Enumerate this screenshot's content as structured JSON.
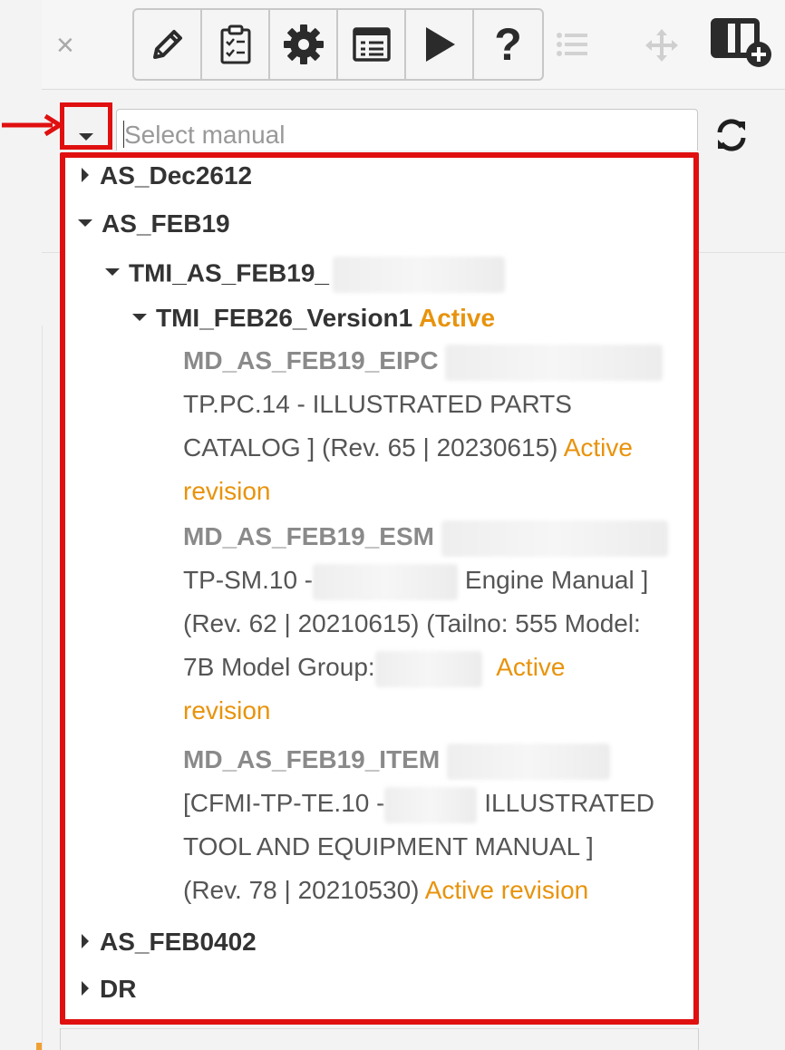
{
  "toolbar": {
    "close_icon": "×",
    "buttons": [
      "edit-pencil-icon",
      "clipboard-checklist-icon",
      "gear-icon",
      "list-document-icon",
      "play-icon",
      "help-question-icon"
    ],
    "help_glyph": "?"
  },
  "search": {
    "placeholder": "Select manual"
  },
  "tree": {
    "root1": "AS_Dec2612",
    "root2": "AS_FEB19",
    "child": "TMI_AS_FEB19_",
    "grandchild": "TMI_FEB26_Version1",
    "grandchild_status": "Active",
    "leaves": [
      {
        "code": "MD_AS_FEB19_EIPC",
        "line2": "TP.PC.14 - ILLUSTRATED PARTS",
        "line3_text": "CATALOG ] (Rev. 65 | 20230615)",
        "line3_status": "Active",
        "line4_status": "revision"
      },
      {
        "code": "MD_AS_FEB19_ESM",
        "line2_pre": "TP-SM.10 -",
        "line2_post": "Engine Manual ]",
        "line3": "(Rev. 62 | 20210615) (Tailno: 555 Model:",
        "line4_pre": "7B Model Group:",
        "line4_status": "Active",
        "line5_status": "revision"
      },
      {
        "code": "MD_AS_FEB19_ITEM",
        "line2_pre": "[CFMI-TP-TE.10 -",
        "line2_post": "ILLUSTRATED",
        "line3": "TOOL AND EQUIPMENT MANUAL ]",
        "line4_text": "(Rev. 78 | 20210530)",
        "line4_status": "Active revision"
      }
    ],
    "root3": "AS_FEB0402",
    "root4": "DR"
  },
  "colors": {
    "highlight_red": "#e01010",
    "active_orange": "#e8930c"
  }
}
